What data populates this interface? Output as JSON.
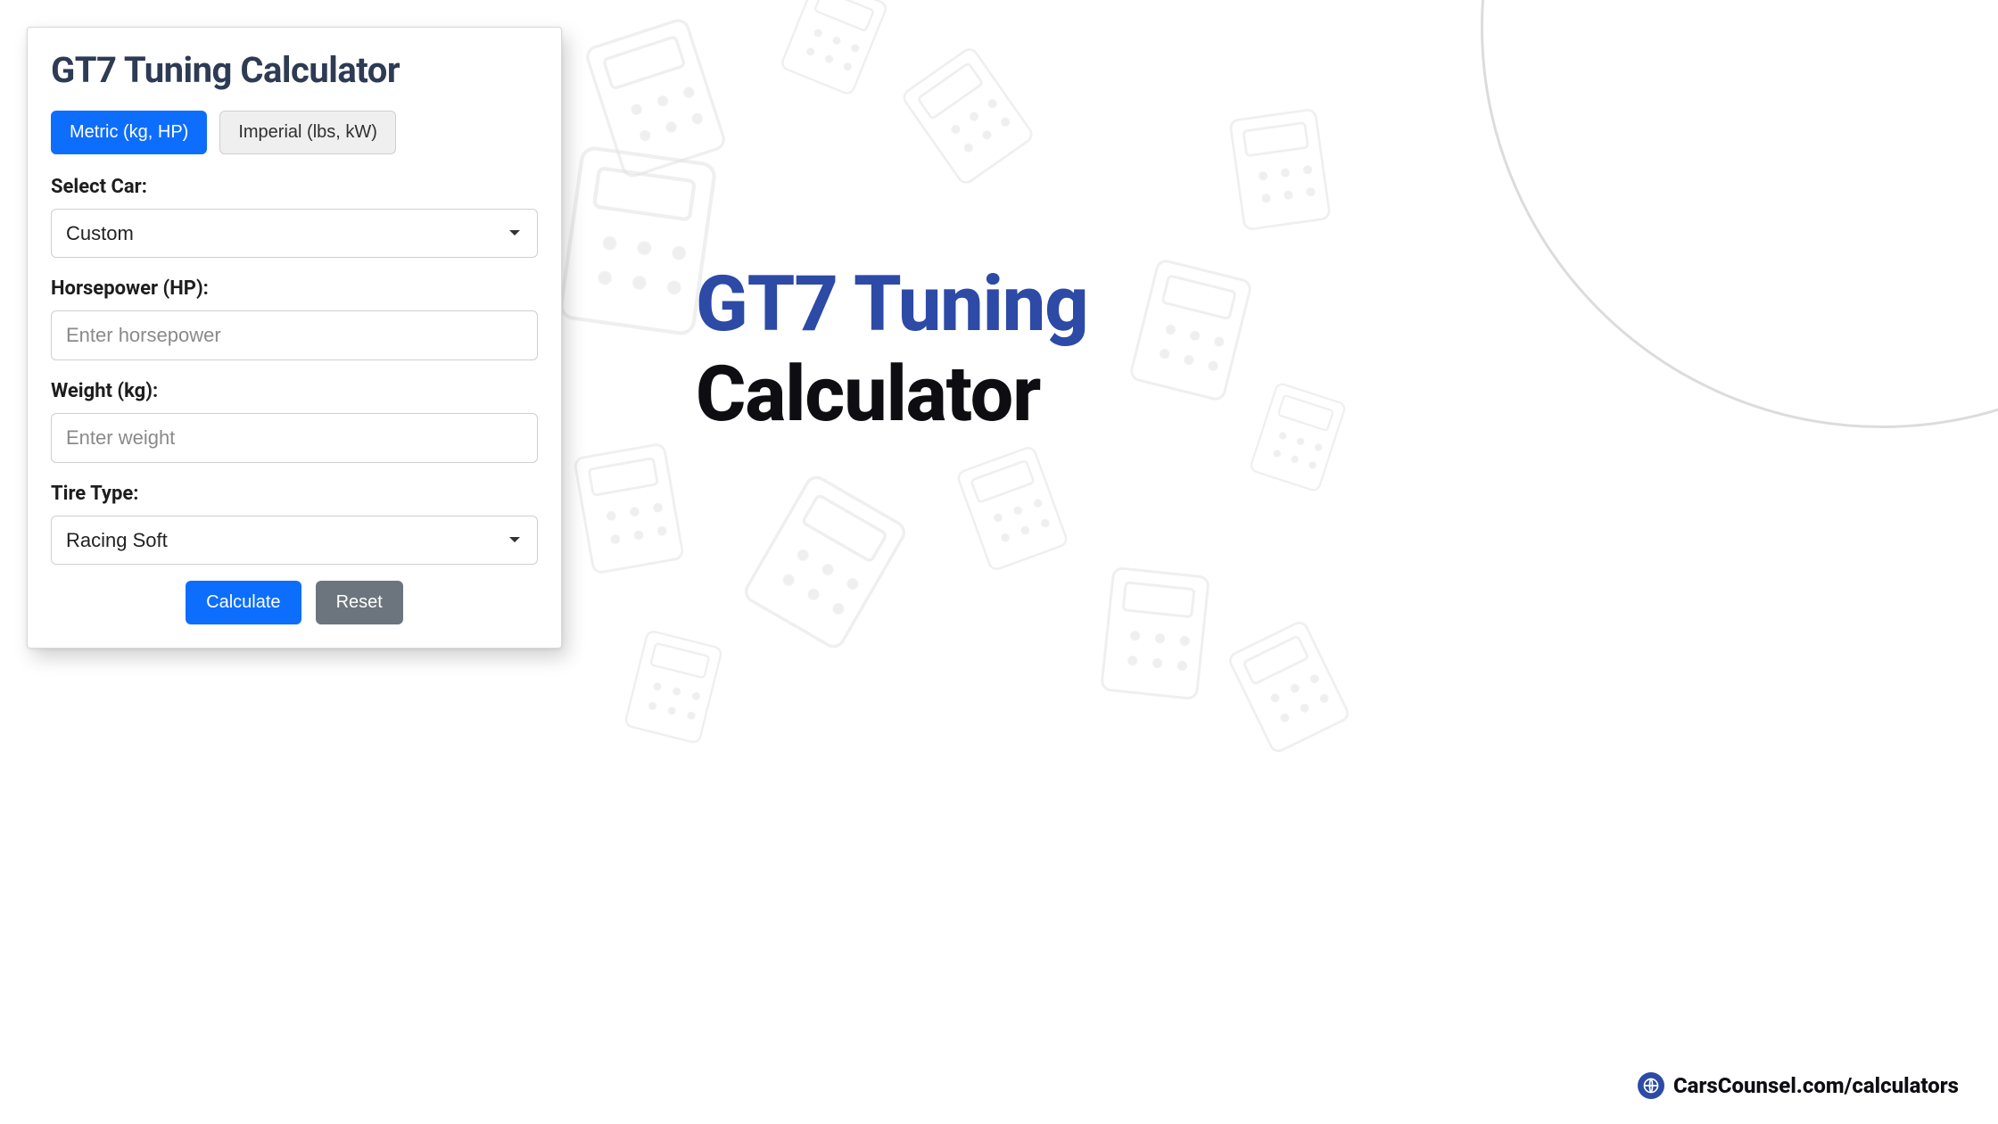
{
  "card": {
    "title": "GT7 Tuning Calculator",
    "unit_buttons": {
      "metric": "Metric (kg, HP)",
      "imperial": "Imperial (lbs, kW)"
    },
    "fields": {
      "select_car": {
        "label": "Select Car:",
        "value": "Custom"
      },
      "horsepower": {
        "label": "Horsepower (HP):",
        "placeholder": "Enter horsepower",
        "value": ""
      },
      "weight": {
        "label": "Weight (kg):",
        "placeholder": "Enter weight",
        "value": ""
      },
      "tire_type": {
        "label": "Tire Type:",
        "value": "Racing Soft"
      }
    },
    "actions": {
      "calculate": "Calculate",
      "reset": "Reset"
    }
  },
  "hero": {
    "line1": "GT7 Tuning",
    "line2": "Calculator"
  },
  "credit": {
    "text": "CarsCounsel.com/calculators"
  }
}
